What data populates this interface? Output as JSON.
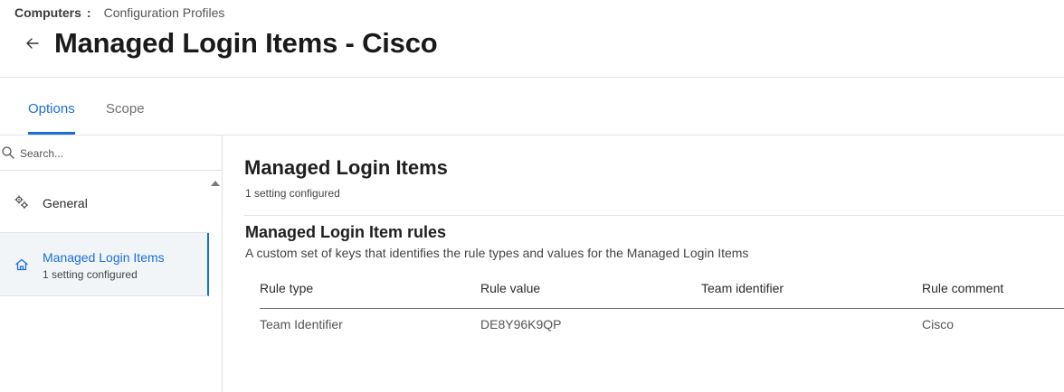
{
  "header": {
    "breadcrumb_root": "Computers",
    "breadcrumb_sep": ":",
    "breadcrumb_current": "Configuration Profiles",
    "title": "Managed Login Items - Cisco"
  },
  "tabs": [
    {
      "label": "Options",
      "active": true
    },
    {
      "label": "Scope",
      "active": false
    }
  ],
  "search": {
    "placeholder": "Search..."
  },
  "sidebar": {
    "items": [
      {
        "label": "General",
        "icon": "gears-icon"
      },
      {
        "label": "Managed Login Items",
        "sublabel": "1 setting configured",
        "icon": "home-icon",
        "selected": true
      }
    ]
  },
  "main": {
    "section_title": "Managed Login Items",
    "section_sub": "1 setting configured",
    "rules_title": "Managed Login Item rules",
    "rules_desc": "A custom set of keys that identifies the rule types and values for the Managed Login Items",
    "columns": [
      "Rule type",
      "Rule value",
      "Team identifier",
      "Rule comment"
    ],
    "rows": [
      [
        "Team Identifier",
        "DE8Y96K9QP",
        "",
        "Cisco"
      ]
    ]
  },
  "colors": {
    "accent": "#1a6ed8",
    "selected_bg": "#f2f5f8",
    "border": "#e3e3e3"
  }
}
